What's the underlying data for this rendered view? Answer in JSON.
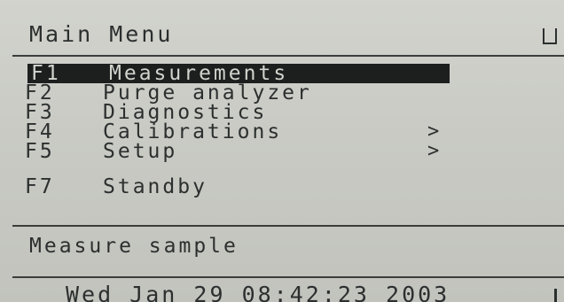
{
  "header": {
    "title": "Main Menu",
    "corner_icon": "bracket-icon"
  },
  "menu": {
    "items": [
      {
        "key": "F1",
        "label": "Measurements",
        "selected": true,
        "submenu": false
      },
      {
        "key": "F2",
        "label": "Purge analyzer",
        "selected": false,
        "submenu": false
      },
      {
        "key": "F3",
        "label": "Diagnostics",
        "selected": false,
        "submenu": false
      },
      {
        "key": "F4",
        "label": "Calibrations",
        "selected": false,
        "submenu": true,
        "arrow": ">"
      },
      {
        "key": "F5",
        "label": "Setup",
        "selected": false,
        "submenu": true,
        "arrow": ">"
      },
      {
        "key": "F7",
        "label": "Standby",
        "selected": false,
        "submenu": false
      }
    ]
  },
  "status": {
    "text": "Measure sample"
  },
  "footer": {
    "datetime": "Wed Jan 29 08:42:23 2003"
  },
  "colors": {
    "screen_bg": "#c9cac4",
    "text": "#2b2f2e",
    "highlight_bg": "#1d1f1f",
    "highlight_text": "#d2d3cd"
  }
}
